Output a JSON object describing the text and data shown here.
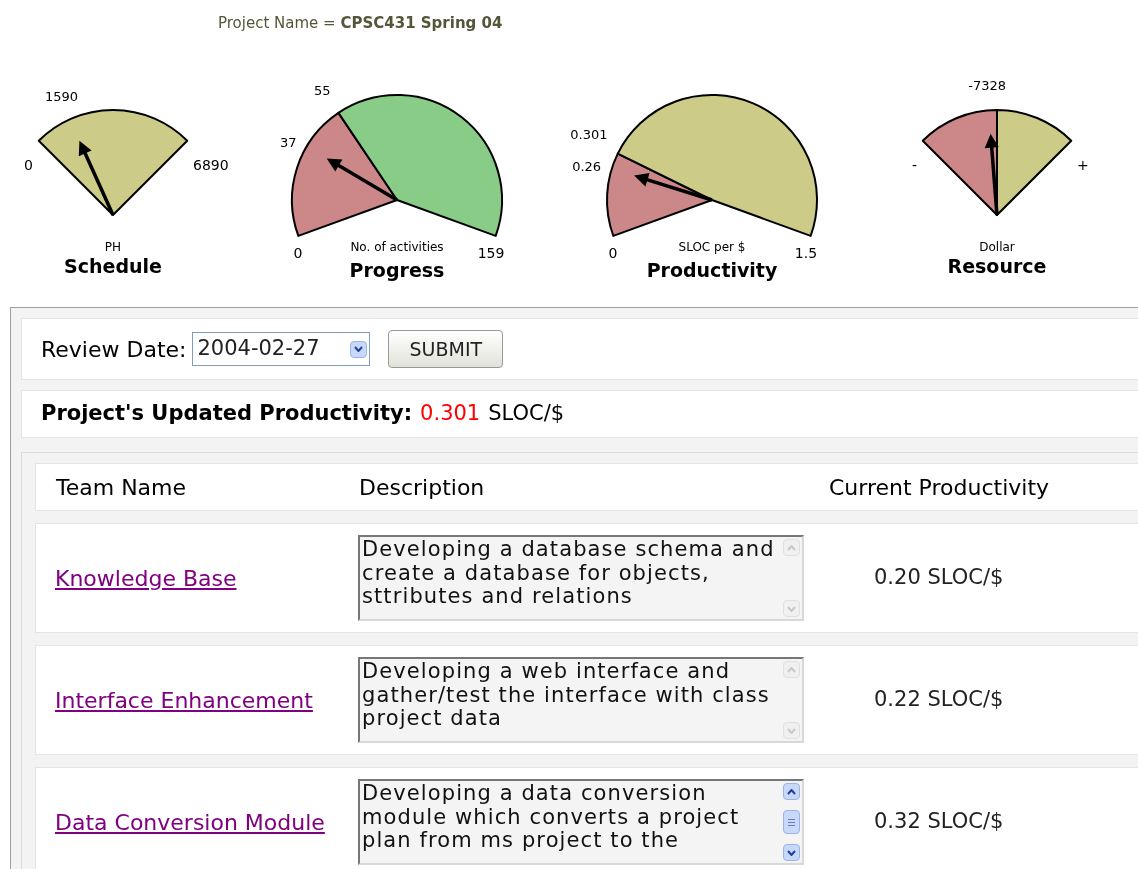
{
  "project": {
    "label": "Project Name = **CPSC431 Spring 04**"
  },
  "gauges": [
    {
      "kind": "narrow",
      "title": "Schedule",
      "unit": "PH",
      "min": "0",
      "max": "6890",
      "value": "1590",
      "zones": [
        {
          "color": "#cccc88"
        }
      ]
    },
    {
      "kind": "wide",
      "title": "Progress",
      "unit": "No. of activities",
      "min": "0",
      "max": "159",
      "value": "37",
      "mark": "55",
      "zones": [
        {
          "color": "#cc8888"
        },
        {
          "color": "#88cc88"
        }
      ]
    },
    {
      "kind": "wide",
      "title": "Productivity",
      "unit": "SLOC per $",
      "min": "0",
      "max": "1.5",
      "value": "0.26",
      "mark": "0.301",
      "zones": [
        {
          "color": "#cc8888"
        },
        {
          "color": "#cccc88"
        }
      ]
    },
    {
      "kind": "narrow",
      "title": "Resource",
      "unit": "Dollar",
      "min": "-",
      "max": "+",
      "value": "-7328",
      "zones": [
        {
          "color": "#cc8888"
        },
        {
          "color": "#cccc88"
        }
      ]
    }
  ],
  "review": {
    "label": "Review Date:",
    "date": "2004-02-27",
    "button": "SUBMIT"
  },
  "productivity": {
    "label": "Project's Updated Productivity:",
    "value": "0.301",
    "unit": "SLOC/$"
  },
  "table": {
    "columns": [
      "Team Name",
      "Description",
      "Current Productivity"
    ],
    "rows": [
      {
        "team": "Knowledge Base",
        "description": "Developing a database schema and create a database for objects, sttributes and relations",
        "productivity": "0.20 SLOC/$",
        "scrollable": false
      },
      {
        "team": "Interface Enhancement",
        "description": "Developing a web interface and gather/test the interface with class project data",
        "productivity": "0.22 SLOC/$",
        "scrollable": false
      },
      {
        "team": "Data Conversion Module",
        "description": "Developing a data conversion module which converts a project plan from ms project to the",
        "productivity": "0.32 SLOC/$",
        "scrollable": true
      }
    ]
  }
}
